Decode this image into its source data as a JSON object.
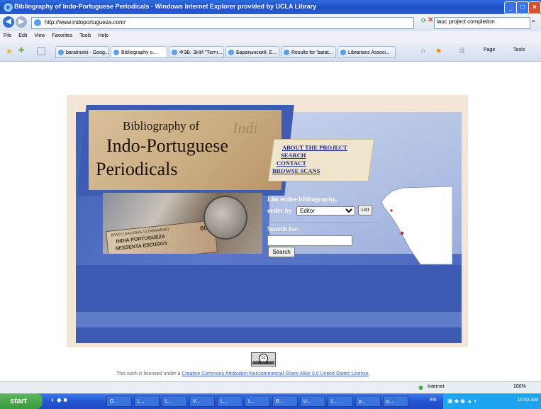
{
  "window": {
    "title": "Bibliography of Indo-Portuguese Periodicals - Windows Internet Explorer provided by UCLA Library"
  },
  "address_bar": {
    "url": "http://www.indoportugueza.com/"
  },
  "search_box": {
    "value": "lauc project completion"
  },
  "menu": [
    "File",
    "Edit",
    "View",
    "Favorites",
    "Tools",
    "Help"
  ],
  "tabs": [
    {
      "label": "baratinskii - Goog..."
    },
    {
      "label": "Bibliography o...",
      "active": true
    },
    {
      "label": "ФЭБ: ЭНИ \"Тютч..."
    },
    {
      "label": "Баратынский, Е..."
    },
    {
      "label": "Results for 'barat..."
    },
    {
      "label": "Librarians Associ..."
    }
  ],
  "toolbar_right": {
    "page": "Page",
    "tools": "Tools"
  },
  "site": {
    "title_line1": "Bibliography of",
    "title_line2": "Indo-Portuguese",
    "title_line3": "Periodicals",
    "watermark": "Indi",
    "nav": [
      "ABOUT THE PROJECT",
      "SEARCH",
      "CONTACT",
      "BROWSE SCANS"
    ],
    "list_label_1": "List entire bibliography,",
    "list_label_2": "order by",
    "order_by_value": "Editor",
    "list_button": "List",
    "search_for": "Search for:",
    "search_button": "Search",
    "banknote_text_1": "BANCO NACIONAL ULTRAMARINO",
    "banknote_text_2": "INDIA PORTUGUEZA",
    "banknote_text_3": "SESSENTA ESCUDOS",
    "banknote_value": "60",
    "cc_badge": "SOME RIGHTS RESERVED",
    "license_prefix": "This work is licensed under a ",
    "license_link": "Creative Commons Attribution-Noncommercial-Share Alike 3.0 United States License",
    "license_suffix": "."
  },
  "statusbar": {
    "zone": "Internet",
    "zoom": "100%"
  },
  "taskbar": {
    "start": "start",
    "items": [
      "G...",
      "L...",
      "L...",
      "V...",
      "L...",
      "L...",
      "B...",
      "U...",
      "L...",
      "p...",
      "p..."
    ],
    "lang": "EN",
    "clock": "10:53 AM"
  },
  "colors": {
    "accent": "#3e5cb2",
    "link": "#1c2a9a",
    "frame": "#f3e6d6"
  }
}
